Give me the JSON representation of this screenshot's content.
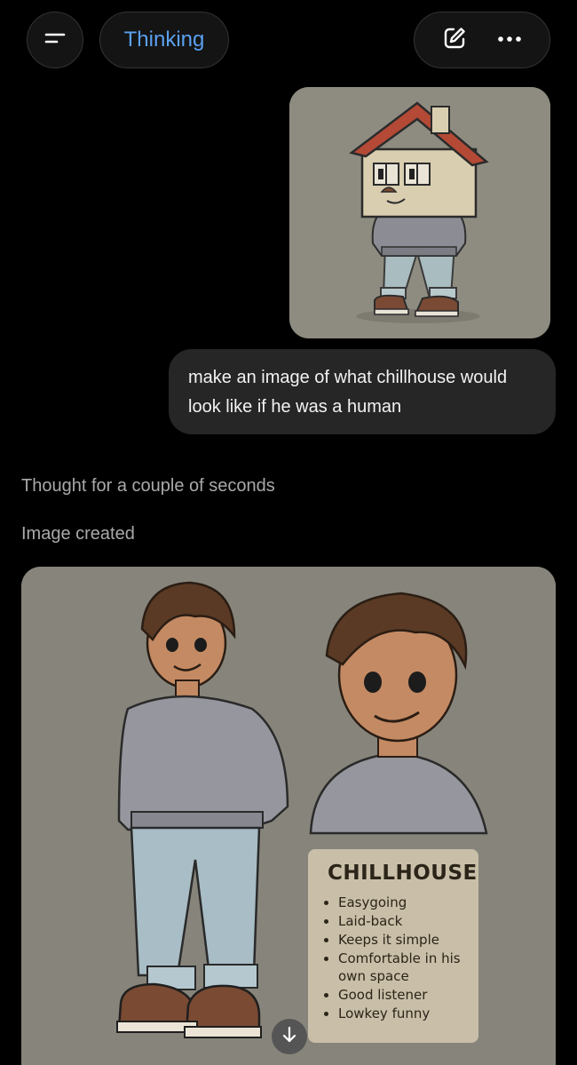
{
  "header": {
    "menu_icon": "menu-icon",
    "model_label": "Thinking",
    "edit_icon": "edit-icon",
    "more_icon": "more-icon"
  },
  "user_message": {
    "attachment_icon": "house-character-image",
    "text": "make an image of what chillhouse would look like if he was a human"
  },
  "assistant": {
    "thought_text": "Thought for a couple of seconds",
    "image_status": "Image created",
    "image_card": {
      "title": "CHILLHOUSE",
      "traits": [
        "Easygoing",
        "Laid-back",
        "Keeps it simple",
        "Comfortable in his own space",
        "Good listener",
        "Lowkey funny"
      ]
    }
  },
  "scroll_icon": "arrow-down-icon"
}
